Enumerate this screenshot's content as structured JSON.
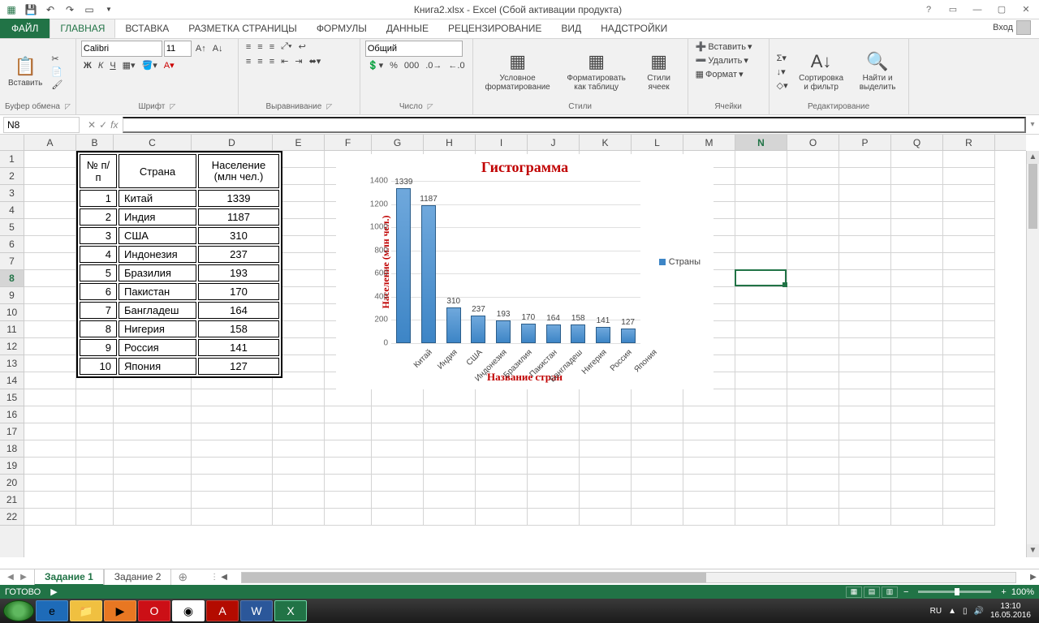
{
  "titlebar": {
    "title": "Книга2.xlsx - Excel (Сбой активации продукта)"
  },
  "ribbon_tabs": {
    "file": "ФАЙЛ",
    "items": [
      "ГЛАВНАЯ",
      "ВСТАВКА",
      "РАЗМЕТКА СТРАНИЦЫ",
      "ФОРМУЛЫ",
      "ДАННЫЕ",
      "РЕЦЕНЗИРОВАНИЕ",
      "ВИД",
      "НАДСТРОЙКИ"
    ],
    "active": 0,
    "signin": "Вход"
  },
  "ribbon": {
    "clipboard": {
      "paste": "Вставить",
      "label": "Буфер обмена"
    },
    "font": {
      "name": "Calibri",
      "size": "11",
      "label": "Шрифт",
      "bold": "Ж",
      "italic": "К",
      "underline": "Ч"
    },
    "align": {
      "label": "Выравнивание"
    },
    "number": {
      "format": "Общий",
      "label": "Число"
    },
    "styles": {
      "cond": "Условное форматирование",
      "table": "Форматировать как таблицу",
      "cell": "Стили ячеек",
      "label": "Стили"
    },
    "cells": {
      "insert": "Вставить",
      "delete": "Удалить",
      "format": "Формат",
      "label": "Ячейки"
    },
    "editing": {
      "sort": "Сортировка и фильтр",
      "find": "Найти и выделить",
      "label": "Редактирование"
    }
  },
  "namebox": "N8",
  "columns": [
    "A",
    "B",
    "C",
    "D",
    "E",
    "F",
    "G",
    "H",
    "I",
    "J",
    "K",
    "L",
    "M",
    "N",
    "O",
    "P",
    "Q",
    "R"
  ],
  "rows_visible": 22,
  "active_row": 8,
  "active_col": "N",
  "table": {
    "headers": [
      "№ п/п",
      "Страна",
      "Население (млн чел.)"
    ],
    "rows": [
      [
        1,
        "Китай",
        1339
      ],
      [
        2,
        "Индия",
        1187
      ],
      [
        3,
        "США",
        310
      ],
      [
        4,
        "Индонезия",
        237
      ],
      [
        5,
        "Бразилия",
        193
      ],
      [
        6,
        "Пакистан",
        170
      ],
      [
        7,
        "Бангладеш",
        164
      ],
      [
        8,
        "Нигерия",
        158
      ],
      [
        9,
        "Россия",
        141
      ],
      [
        10,
        "Япония",
        127
      ]
    ]
  },
  "chart_data": {
    "type": "bar",
    "title": "Гистограмма",
    "ylabel": "Население (млн чел.)",
    "xlabel": "Название стран",
    "legend": "Страны",
    "categories": [
      "Китай",
      "Индия",
      "США",
      "Индонезия",
      "Бразилия",
      "Пакистан",
      "Бангладеш",
      "Нигерия",
      "Россия",
      "Япония"
    ],
    "values": [
      1339,
      1187,
      310,
      237,
      193,
      170,
      164,
      158,
      141,
      127
    ],
    "ylim": [
      0,
      1400
    ],
    "yticks": [
      0,
      200,
      400,
      600,
      800,
      1000,
      1200,
      1400
    ]
  },
  "sheet_tabs": {
    "items": [
      "Задание 1",
      "Задание 2"
    ],
    "active": 0
  },
  "statusbar": {
    "ready": "ГОТОВО",
    "zoom": "100%"
  },
  "taskbar": {
    "lang": "RU",
    "time": "13:10",
    "date": "16.05.2016"
  }
}
